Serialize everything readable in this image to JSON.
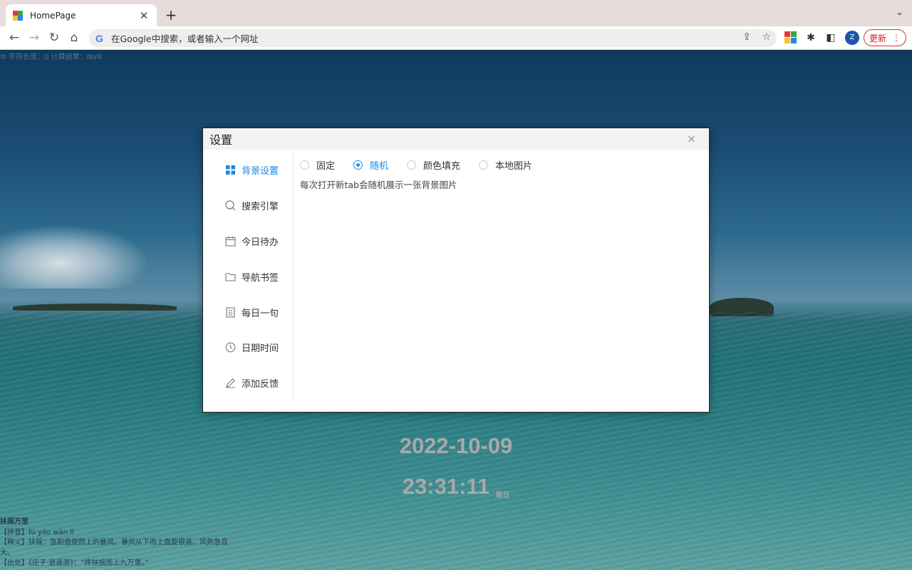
{
  "browser": {
    "tab_title": "HomePage",
    "tab_close": "✕",
    "new_tab": "+",
    "omnibox_text": "在Google中搜索，或者输入一个网址",
    "avatar_letter": "Z",
    "update_label": "更新"
  },
  "page": {
    "counter_text": "字符长度：0  计算结果：NaN",
    "date": "2022-10-09",
    "time": "23:31:11",
    "weekday": "周日",
    "quote": {
      "title": "扶摇万里",
      "pinyin": "【拼音】fú yáo wàn lǐ",
      "meaning": "【释义】扶摇：急剧盘旋而上的暴风。暴风从下而上盘旋很高。风势急且大。",
      "source": "【出处】《庄子·逍遥游》：“抟扶摇而上九万里。”"
    }
  },
  "dialog": {
    "title": "设置",
    "close_label": "×",
    "nav": [
      {
        "label": "背景设置",
        "icon": "grid-icon",
        "active": true
      },
      {
        "label": "搜索引擎",
        "icon": "search-icon",
        "active": false
      },
      {
        "label": "今日待办",
        "icon": "calendar-icon",
        "active": false
      },
      {
        "label": "导航书签",
        "icon": "folder-icon",
        "active": false
      },
      {
        "label": "每日一句",
        "icon": "document-icon",
        "active": false
      },
      {
        "label": "日期时间",
        "icon": "clock-icon",
        "active": false
      },
      {
        "label": "添加反馈",
        "icon": "edit-icon",
        "active": false
      }
    ],
    "background_options": [
      {
        "label": "固定",
        "selected": false
      },
      {
        "label": "随机",
        "selected": true
      },
      {
        "label": "颜色填充",
        "selected": false
      },
      {
        "label": "本地图片",
        "selected": false
      }
    ],
    "hint": "每次打开新tab会随机展示一张背景图片"
  },
  "colors": {
    "accent": "#1e88e5",
    "update_red": "#cc2222"
  }
}
